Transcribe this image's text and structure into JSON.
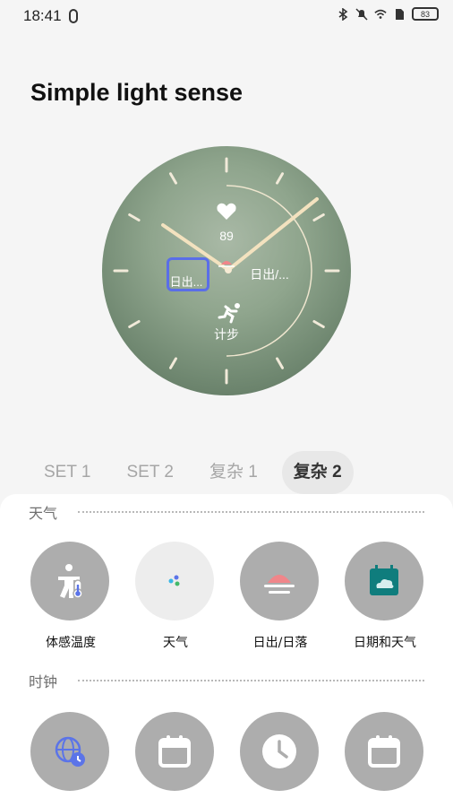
{
  "status": {
    "time": "18:41",
    "battery": "83"
  },
  "page": {
    "title": "Simple light sense"
  },
  "watchface": {
    "heart_rate": "89",
    "sunrise_label": "日出...",
    "date_label": "日出/...",
    "steps_label": "计步"
  },
  "tabs": [
    {
      "label": "SET 1",
      "active": false
    },
    {
      "label": "SET 2",
      "active": false
    },
    {
      "label": "复杂 1",
      "active": false
    },
    {
      "label": "复杂 2",
      "active": true
    }
  ],
  "sections": {
    "weather": {
      "title": "天气",
      "options": [
        {
          "label": "体感温度",
          "icon": "feels-like-temperature-icon"
        },
        {
          "label": "天气",
          "icon": "weather-dots-icon"
        },
        {
          "label": "日出/日落",
          "icon": "sunrise-sunset-icon"
        },
        {
          "label": "日期和天气",
          "icon": "date-weather-icon"
        }
      ]
    },
    "clock": {
      "title": "时钟",
      "options": [
        {
          "label": "",
          "icon": "world-clock-icon"
        },
        {
          "label": "",
          "icon": "calendar-icon"
        },
        {
          "label": "",
          "icon": "clock-icon"
        },
        {
          "label": "",
          "icon": "calendar-icon"
        }
      ]
    }
  }
}
